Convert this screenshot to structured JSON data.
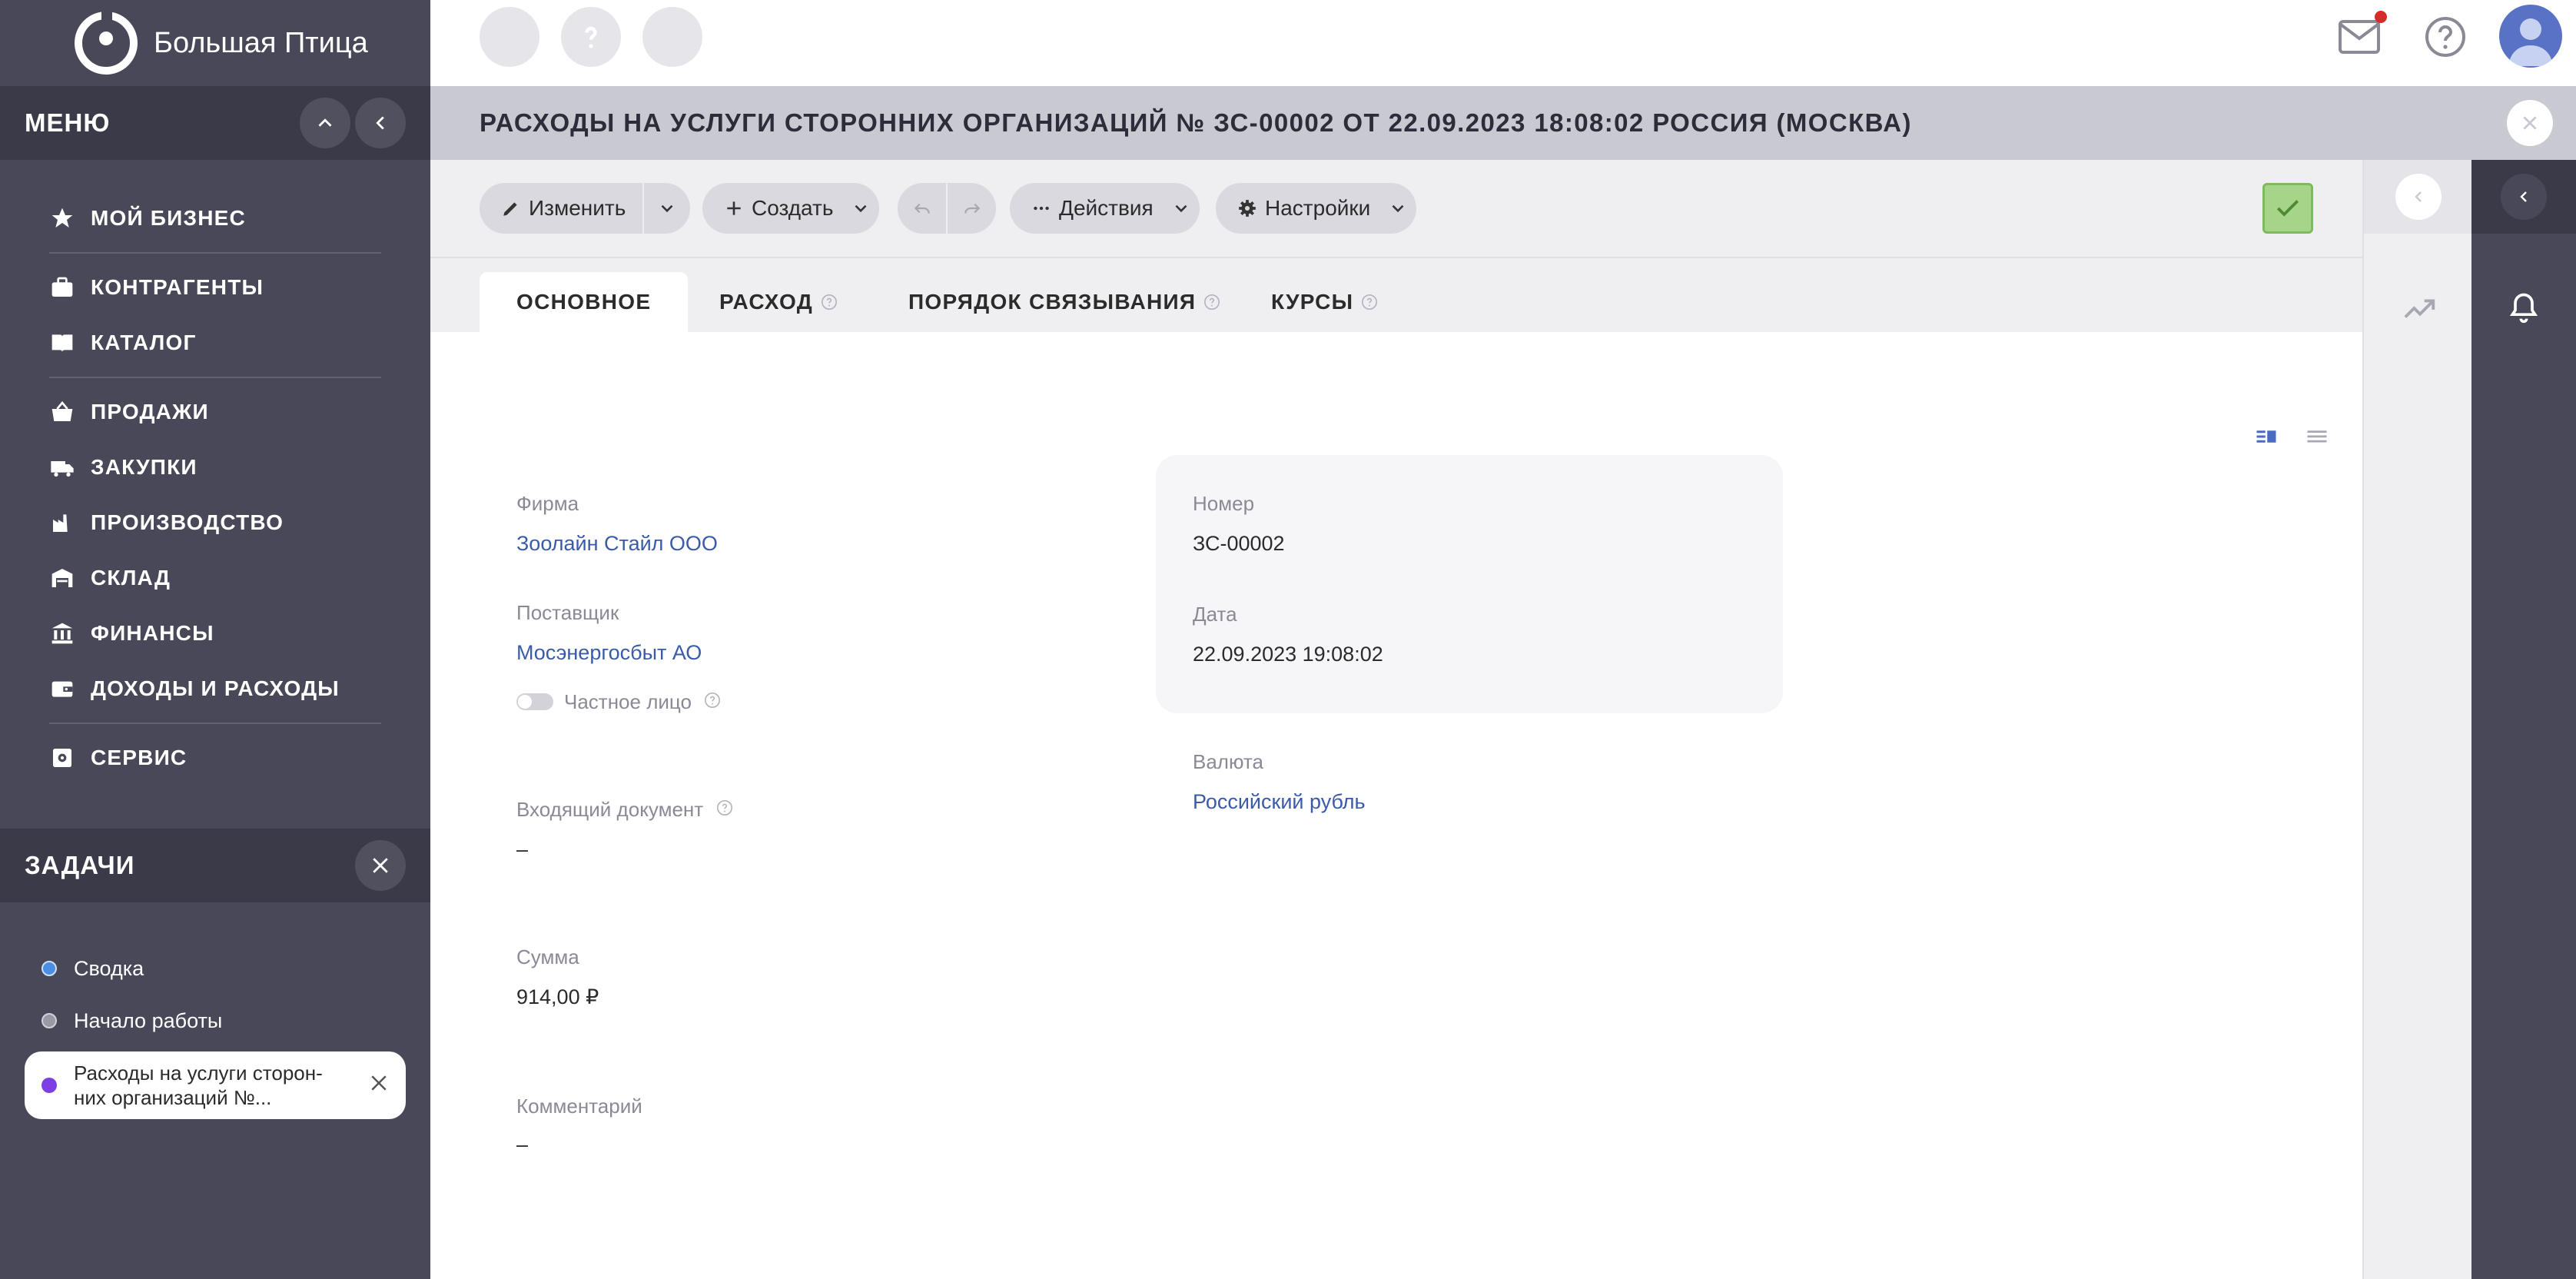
{
  "brand": {
    "name": "Большая Птица"
  },
  "menu": {
    "title": "МЕНЮ",
    "items": [
      {
        "label": "МОЙ БИЗНЕС",
        "icon": "star-icon"
      },
      {
        "label": "КОНТРАГЕНТЫ",
        "icon": "briefcase-icon"
      },
      {
        "label": "КАТАЛОГ",
        "icon": "book-icon"
      },
      {
        "label": "ПРОДАЖИ",
        "icon": "basket-icon"
      },
      {
        "label": "ЗАКУПКИ",
        "icon": "truck-icon"
      },
      {
        "label": "ПРОИЗВОДСТВО",
        "icon": "factory-icon"
      },
      {
        "label": "СКЛАД",
        "icon": "warehouse-icon"
      },
      {
        "label": "ФИНАНСЫ",
        "icon": "bank-icon"
      },
      {
        "label": "ДОХОДЫ И РАСХОДЫ",
        "icon": "wallet-icon"
      },
      {
        "label": "СЕРВИС",
        "icon": "service-icon"
      }
    ]
  },
  "tasks": {
    "title": "ЗАДАЧИ",
    "items": [
      {
        "label": "Сводка",
        "dot_color": "#4a90e2"
      },
      {
        "label": "Начало работы",
        "dot_color": "#9a9aa6"
      },
      {
        "label": "Расходы на услуги сторон-\nних организаций №...",
        "dot_color": "#7b3fe4",
        "active": true
      }
    ]
  },
  "document": {
    "title": "РАСХОДЫ НА УСЛУГИ СТОРОННИХ ОРГАНИЗАЦИЙ № ЗС-00002 ОТ 22.09.2023 18:08:02 РОССИЯ (МОСКВА)"
  },
  "toolbar": {
    "edit_label": "Изменить",
    "create_label": "Создать",
    "actions_label": "Действия",
    "settings_label": "Настройки"
  },
  "tabs": [
    {
      "label": "ОСНОВНОЕ",
      "active": true
    },
    {
      "label": "РАСХОД",
      "has_help": true
    },
    {
      "label": "ПОРЯДОК СВЯЗЫВАНИЯ",
      "has_help": true
    },
    {
      "label": "КУРСЫ",
      "has_help": true
    }
  ],
  "form": {
    "firm": {
      "label": "Фирма",
      "value": "Зоолайн Стайл ООО"
    },
    "supplier": {
      "label": "Поставщик",
      "value": "Мосэнергосбыт АО"
    },
    "private_person": {
      "label": "Частное лицо",
      "checked": false
    },
    "number": {
      "label": "Номер",
      "value": "ЗС-00002"
    },
    "date": {
      "label": "Дата",
      "value": "22.09.2023 19:08:02"
    },
    "currency": {
      "label": "Валюта",
      "value": "Российский рубль"
    },
    "incoming_doc": {
      "label": "Входящий документ",
      "value": "–"
    },
    "amount": {
      "label": "Сумма",
      "value": "914,00 ₽"
    },
    "comment": {
      "label": "Комментарий",
      "value": "–"
    }
  },
  "colors": {
    "sidebar_bg": "#484858",
    "sidebar_header_bg": "#3a3a48",
    "title_band_bg": "#c9c9d1",
    "link": "#3a5ba8",
    "confirm_green": "#a6d58a",
    "mail_badge": "#d52b2b"
  }
}
